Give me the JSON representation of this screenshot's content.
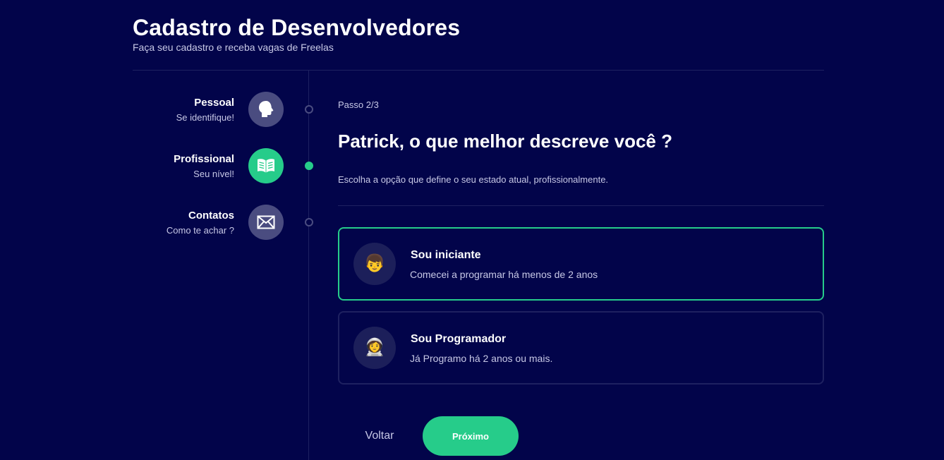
{
  "header": {
    "title": "Cadastro de Desenvolvedores",
    "subtitle": "Faça seu cadastro e receba vagas de Freelas"
  },
  "steps": [
    {
      "title": "Pessoal",
      "description": "Se identifique!",
      "icon": "head-icon",
      "state": "completed"
    },
    {
      "title": "Profissional",
      "description": "Seu nível!",
      "icon": "book-icon",
      "state": "active"
    },
    {
      "title": "Contatos",
      "description": "Como te achar ?",
      "icon": "envelope-icon",
      "state": "pending"
    }
  ],
  "content": {
    "step_counter": "Passo 2/3",
    "question": "Patrick, o que melhor descreve você ?",
    "instruction": "Escolha a opção que define o seu estado atual, profissionalmente."
  },
  "options": [
    {
      "title": "Sou iniciante",
      "description": "Comecei a programar há menos de 2 anos",
      "icon": "boy-emoji",
      "emoji": "👦",
      "selected": true
    },
    {
      "title": "Sou Programador",
      "description": "Já Programo há 2 anos ou mais.",
      "icon": "astronaut-emoji",
      "emoji": "👩‍🚀",
      "selected": false
    }
  ],
  "buttons": {
    "back_label": "Voltar",
    "next_label": "Próximo"
  },
  "colors": {
    "background": "#02044a",
    "accent": "#26cc8a",
    "inactive_step": "#4a4c80",
    "divider": "#1e2160",
    "muted_text": "#c7c8e6"
  }
}
